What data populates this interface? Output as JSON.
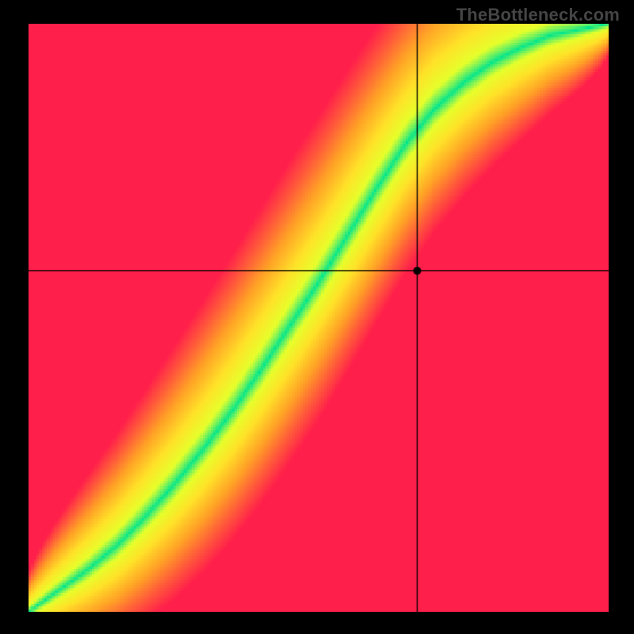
{
  "watermark": "TheBottleneck.com",
  "chart_data": {
    "type": "heatmap",
    "title": "",
    "xlabel": "",
    "ylabel": "",
    "xlim": [
      0,
      1
    ],
    "ylim": [
      0,
      1
    ],
    "crosshair": {
      "x": 0.67,
      "y": 0.58
    },
    "marker": {
      "x": 0.67,
      "y": 0.58,
      "radius": 5
    },
    "ridge": {
      "description": "Optimal (green) band following an S-shaped curve from lower-left to upper-right",
      "points": [
        {
          "x": 0.0,
          "y": 0.0
        },
        {
          "x": 0.05,
          "y": 0.035
        },
        {
          "x": 0.1,
          "y": 0.07
        },
        {
          "x": 0.15,
          "y": 0.11
        },
        {
          "x": 0.2,
          "y": 0.16
        },
        {
          "x": 0.25,
          "y": 0.215
        },
        {
          "x": 0.3,
          "y": 0.275
        },
        {
          "x": 0.35,
          "y": 0.34
        },
        {
          "x": 0.4,
          "y": 0.41
        },
        {
          "x": 0.45,
          "y": 0.485
        },
        {
          "x": 0.5,
          "y": 0.56
        },
        {
          "x": 0.55,
          "y": 0.64
        },
        {
          "x": 0.6,
          "y": 0.72
        },
        {
          "x": 0.65,
          "y": 0.795
        },
        {
          "x": 0.7,
          "y": 0.855
        },
        {
          "x": 0.75,
          "y": 0.9
        },
        {
          "x": 0.8,
          "y": 0.935
        },
        {
          "x": 0.85,
          "y": 0.96
        },
        {
          "x": 0.9,
          "y": 0.98
        },
        {
          "x": 0.95,
          "y": 0.99
        },
        {
          "x": 1.0,
          "y": 1.0
        }
      ],
      "band_width_fraction_min": 0.02,
      "band_width_fraction_max": 0.09
    },
    "color_stops": [
      {
        "t": 0.0,
        "color": "#00e58e"
      },
      {
        "t": 0.18,
        "color": "#e6ff2b"
      },
      {
        "t": 0.38,
        "color": "#ffe228"
      },
      {
        "t": 0.62,
        "color": "#ffa126"
      },
      {
        "t": 0.82,
        "color": "#ff5a3a"
      },
      {
        "t": 1.0,
        "color": "#ff1f4b"
      }
    ],
    "resolution": 220
  }
}
